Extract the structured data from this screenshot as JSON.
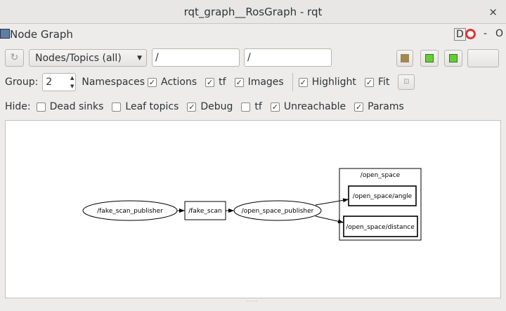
{
  "window": {
    "title": "rqt_graph__RosGraph - rqt",
    "close": "×"
  },
  "plugin": {
    "title": "Node Graph",
    "d_label": "D",
    "minimize": "-",
    "float": "O"
  },
  "toolbar": {
    "mode": "Nodes/Topics (all)",
    "node_filter": "/",
    "topic_filter": "/"
  },
  "group": {
    "label": "Group:",
    "value": "2",
    "options": [
      {
        "label": "Namespaces",
        "checked": true
      },
      {
        "label": "Actions",
        "checked": true
      },
      {
        "label": "tf",
        "checked": true
      },
      {
        "label": "Images",
        "checked": true
      },
      {
        "label": "Highlight",
        "checked": true
      },
      {
        "label": "Fit",
        "checked": true
      }
    ]
  },
  "hide": {
    "label": "Hide:",
    "options": [
      {
        "label": "Dead sinks",
        "checked": false
      },
      {
        "label": "Leaf topics",
        "checked": false
      },
      {
        "label": "Debug",
        "checked": true
      },
      {
        "label": "tf",
        "checked": false
      },
      {
        "label": "Unreachable",
        "checked": true
      },
      {
        "label": "Params",
        "checked": true
      }
    ]
  },
  "graph": {
    "nodes": [
      "/fake_scan_publisher",
      "/open_space_publisher"
    ],
    "topics": [
      "/fake_scan",
      "/open_space/angle",
      "/open_space/distance"
    ],
    "namespace": "/open_space"
  }
}
